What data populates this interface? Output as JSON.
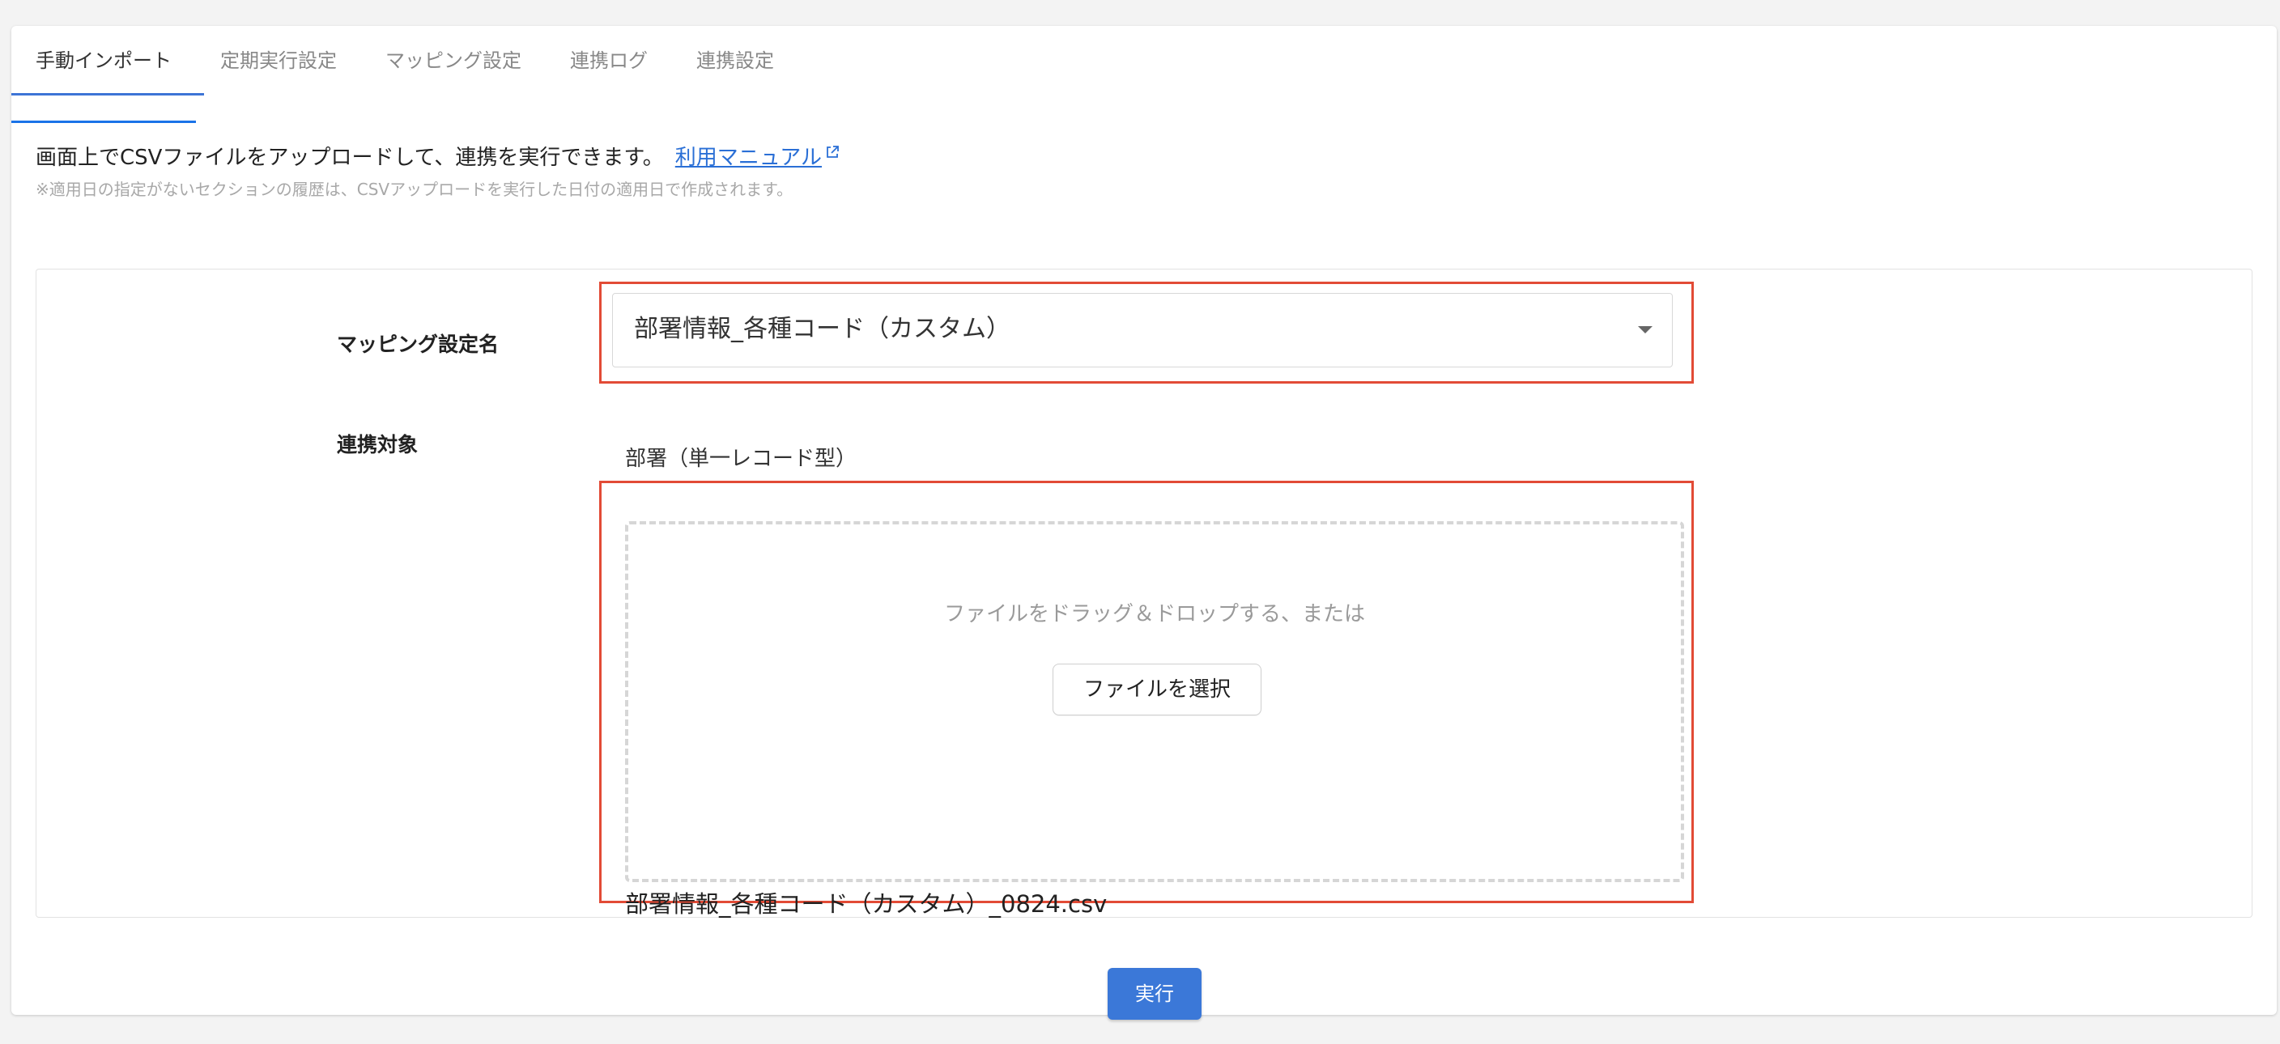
{
  "tabs": [
    {
      "label": "手動インポート",
      "active": true
    },
    {
      "label": "定期実行設定",
      "active": false
    },
    {
      "label": "マッピング設定",
      "active": false
    },
    {
      "label": "連携ログ",
      "active": false
    },
    {
      "label": "連携設定",
      "active": false
    }
  ],
  "description": {
    "text": "画面上でCSVファイルをアップロードして、連携を実行できます。",
    "manual_link": "利用マニュアル",
    "note": "※適用日の指定がないセクションの履歴は、CSVアップロードを実行した日付の適用日で作成されます。"
  },
  "form": {
    "mapping_label": "マッピング設定名",
    "mapping_value": "部署情報_各種コード（カスタム）",
    "target_label": "連携対象",
    "target_value": "部署（単一レコード型）",
    "dropzone_text": "ファイルをドラッグ＆ドロップする、または",
    "choose_file_label": "ファイルを選択",
    "selected_file": "部署情報_各種コード（カスタム）_0824.csv"
  },
  "actions": {
    "run_label": "実行"
  },
  "colors": {
    "accent": "#3b78d8",
    "link": "#2a6fd6",
    "highlight": "#e24b36"
  }
}
